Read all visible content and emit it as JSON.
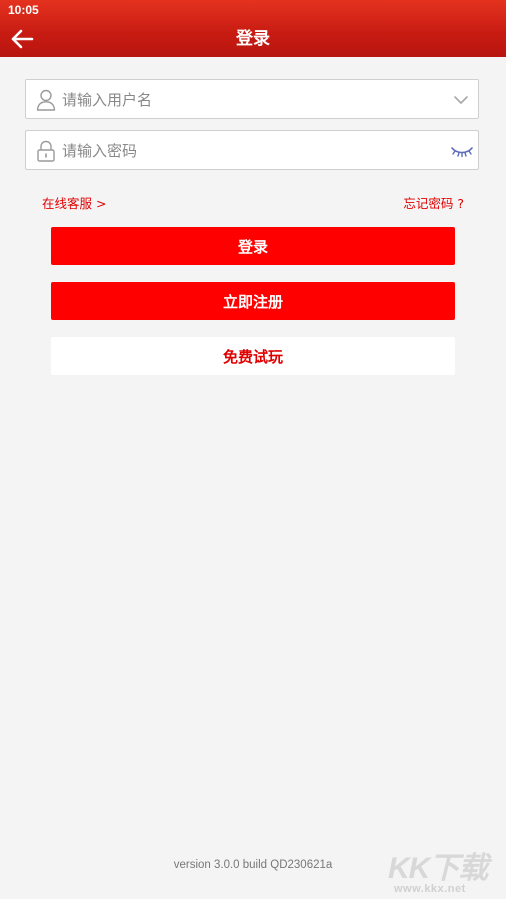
{
  "status_bar": {
    "time": "10:05"
  },
  "header": {
    "title": "登录",
    "back_icon": "arrow-left-icon"
  },
  "form": {
    "username": {
      "placeholder": "请输入用户名",
      "value": "",
      "icon": "user-icon",
      "right_icon": "chevron-down-icon"
    },
    "password": {
      "placeholder": "请输入密码",
      "value": "",
      "icon": "lock-icon",
      "right_icon": "eye-closed-icon"
    }
  },
  "links": {
    "online_service": "在线客服 >",
    "forgot_password": "忘记密码 ?"
  },
  "buttons": {
    "login": "登录",
    "register": "立即注册",
    "free_trial": "免费试玩"
  },
  "footer": {
    "version": "version 3.0.0 build QD230621a"
  },
  "watermark": {
    "logo": "KK下载",
    "url": "www.kkx.net"
  },
  "colors": {
    "header": "#d42a1b",
    "accent": "#ff0000",
    "background": "#f4f4f4"
  }
}
